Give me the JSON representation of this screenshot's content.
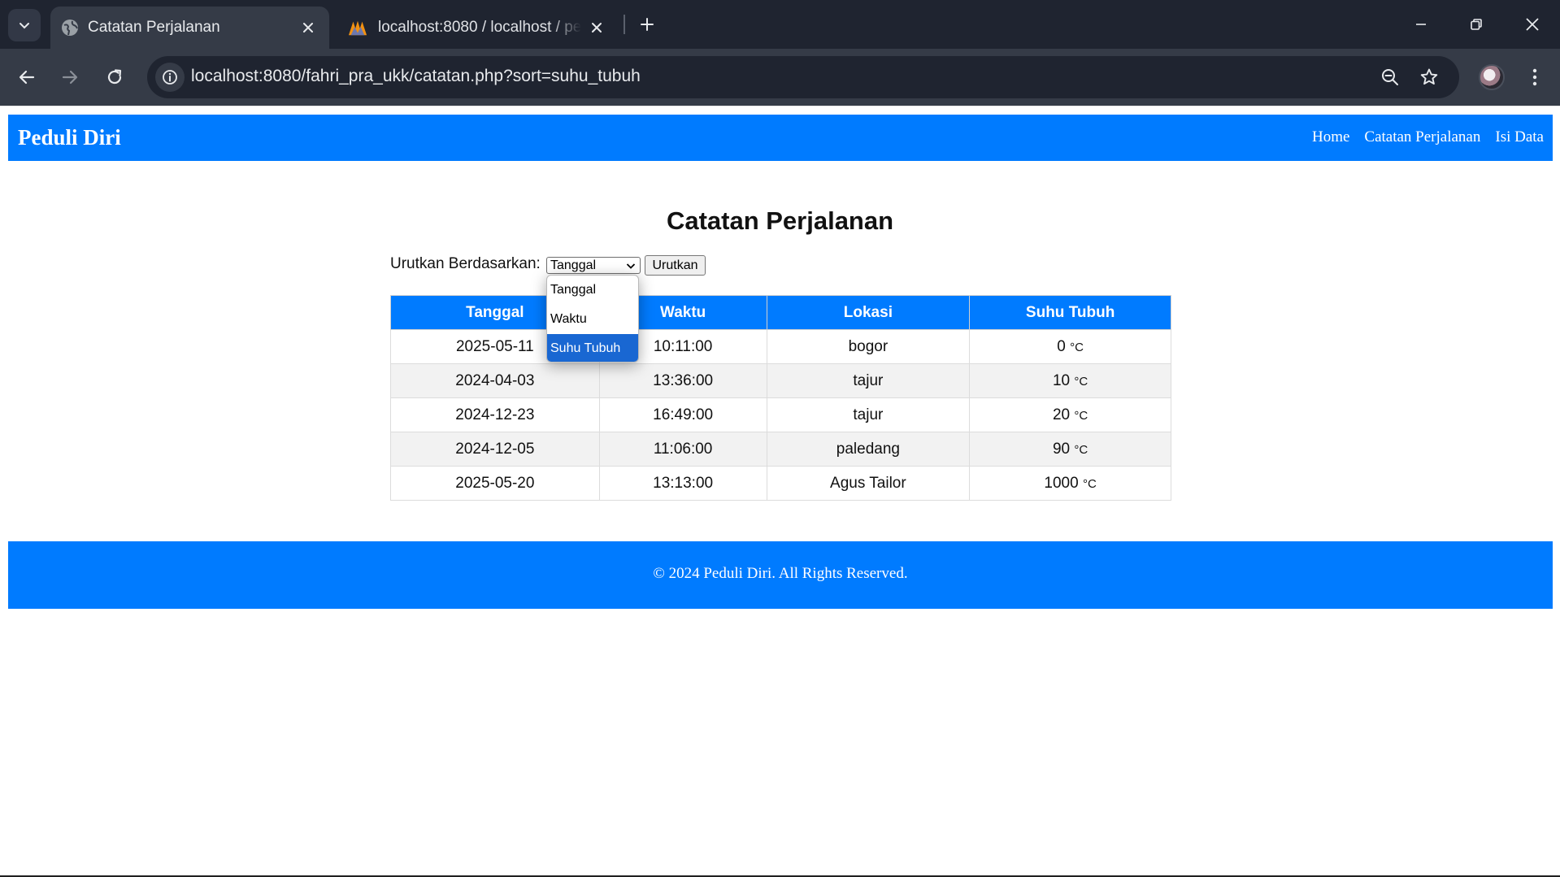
{
  "browser": {
    "tabs": [
      {
        "title": "Catatan Perjalanan",
        "active": true
      },
      {
        "title": "localhost:8080 / localhost / perjalanan",
        "active": false
      }
    ],
    "url": "localhost:8080/fahri_pra_ukk/catatan.php?sort=suhu_tubuh"
  },
  "site": {
    "brand": "Peduli Diri",
    "nav": [
      {
        "label": "Home"
      },
      {
        "label": "Catatan Perjalanan"
      },
      {
        "label": "Isi Data"
      }
    ],
    "accent_color": "#007bff"
  },
  "main": {
    "title": "Catatan Perjalanan",
    "sort": {
      "label": "Urutkan Berdasarkan:",
      "selected": "Tanggal",
      "options": [
        "Tanggal",
        "Waktu",
        "Suhu Tubuh"
      ],
      "highlighted_option": "Suhu Tubuh",
      "button_label": "Urutkan"
    },
    "table": {
      "columns": [
        "Tanggal",
        "Waktu",
        "Lokasi",
        "Suhu Tubuh"
      ],
      "unit": "°C",
      "rows": [
        {
          "tanggal": "2025-05-11",
          "waktu": "10:11:00",
          "lokasi": "bogor",
          "suhu": "0"
        },
        {
          "tanggal": "2024-04-03",
          "waktu": "13:36:00",
          "lokasi": "tajur",
          "suhu": "10"
        },
        {
          "tanggal": "2024-12-23",
          "waktu": "16:49:00",
          "lokasi": "tajur",
          "suhu": "20"
        },
        {
          "tanggal": "2024-12-05",
          "waktu": "11:06:00",
          "lokasi": "paledang",
          "suhu": "90"
        },
        {
          "tanggal": "2025-05-20",
          "waktu": "13:13:00",
          "lokasi": "Agus Tailor",
          "suhu": "1000"
        }
      ]
    }
  },
  "footer": {
    "text": "© 2024 Peduli Diri. All Rights Reserved."
  }
}
